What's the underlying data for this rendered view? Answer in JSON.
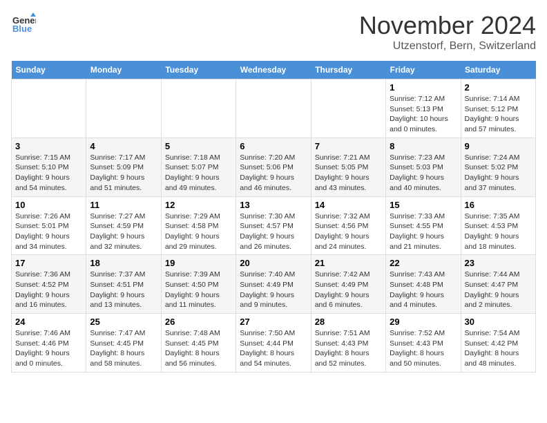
{
  "logo": {
    "line1": "General",
    "line2": "Blue"
  },
  "title": "November 2024",
  "subtitle": "Utzenstorf, Bern, Switzerland",
  "weekdays": [
    "Sunday",
    "Monday",
    "Tuesday",
    "Wednesday",
    "Thursday",
    "Friday",
    "Saturday"
  ],
  "weeks": [
    [
      {
        "day": "",
        "info": ""
      },
      {
        "day": "",
        "info": ""
      },
      {
        "day": "",
        "info": ""
      },
      {
        "day": "",
        "info": ""
      },
      {
        "day": "",
        "info": ""
      },
      {
        "day": "1",
        "info": "Sunrise: 7:12 AM\nSunset: 5:13 PM\nDaylight: 10 hours\nand 0 minutes."
      },
      {
        "day": "2",
        "info": "Sunrise: 7:14 AM\nSunset: 5:12 PM\nDaylight: 9 hours\nand 57 minutes."
      }
    ],
    [
      {
        "day": "3",
        "info": "Sunrise: 7:15 AM\nSunset: 5:10 PM\nDaylight: 9 hours\nand 54 minutes."
      },
      {
        "day": "4",
        "info": "Sunrise: 7:17 AM\nSunset: 5:09 PM\nDaylight: 9 hours\nand 51 minutes."
      },
      {
        "day": "5",
        "info": "Sunrise: 7:18 AM\nSunset: 5:07 PM\nDaylight: 9 hours\nand 49 minutes."
      },
      {
        "day": "6",
        "info": "Sunrise: 7:20 AM\nSunset: 5:06 PM\nDaylight: 9 hours\nand 46 minutes."
      },
      {
        "day": "7",
        "info": "Sunrise: 7:21 AM\nSunset: 5:05 PM\nDaylight: 9 hours\nand 43 minutes."
      },
      {
        "day": "8",
        "info": "Sunrise: 7:23 AM\nSunset: 5:03 PM\nDaylight: 9 hours\nand 40 minutes."
      },
      {
        "day": "9",
        "info": "Sunrise: 7:24 AM\nSunset: 5:02 PM\nDaylight: 9 hours\nand 37 minutes."
      }
    ],
    [
      {
        "day": "10",
        "info": "Sunrise: 7:26 AM\nSunset: 5:01 PM\nDaylight: 9 hours\nand 34 minutes."
      },
      {
        "day": "11",
        "info": "Sunrise: 7:27 AM\nSunset: 4:59 PM\nDaylight: 9 hours\nand 32 minutes."
      },
      {
        "day": "12",
        "info": "Sunrise: 7:29 AM\nSunset: 4:58 PM\nDaylight: 9 hours\nand 29 minutes."
      },
      {
        "day": "13",
        "info": "Sunrise: 7:30 AM\nSunset: 4:57 PM\nDaylight: 9 hours\nand 26 minutes."
      },
      {
        "day": "14",
        "info": "Sunrise: 7:32 AM\nSunset: 4:56 PM\nDaylight: 9 hours\nand 24 minutes."
      },
      {
        "day": "15",
        "info": "Sunrise: 7:33 AM\nSunset: 4:55 PM\nDaylight: 9 hours\nand 21 minutes."
      },
      {
        "day": "16",
        "info": "Sunrise: 7:35 AM\nSunset: 4:53 PM\nDaylight: 9 hours\nand 18 minutes."
      }
    ],
    [
      {
        "day": "17",
        "info": "Sunrise: 7:36 AM\nSunset: 4:52 PM\nDaylight: 9 hours\nand 16 minutes."
      },
      {
        "day": "18",
        "info": "Sunrise: 7:37 AM\nSunset: 4:51 PM\nDaylight: 9 hours\nand 13 minutes."
      },
      {
        "day": "19",
        "info": "Sunrise: 7:39 AM\nSunset: 4:50 PM\nDaylight: 9 hours\nand 11 minutes."
      },
      {
        "day": "20",
        "info": "Sunrise: 7:40 AM\nSunset: 4:49 PM\nDaylight: 9 hours\nand 9 minutes."
      },
      {
        "day": "21",
        "info": "Sunrise: 7:42 AM\nSunset: 4:49 PM\nDaylight: 9 hours\nand 6 minutes."
      },
      {
        "day": "22",
        "info": "Sunrise: 7:43 AM\nSunset: 4:48 PM\nDaylight: 9 hours\nand 4 minutes."
      },
      {
        "day": "23",
        "info": "Sunrise: 7:44 AM\nSunset: 4:47 PM\nDaylight: 9 hours\nand 2 minutes."
      }
    ],
    [
      {
        "day": "24",
        "info": "Sunrise: 7:46 AM\nSunset: 4:46 PM\nDaylight: 9 hours\nand 0 minutes."
      },
      {
        "day": "25",
        "info": "Sunrise: 7:47 AM\nSunset: 4:45 PM\nDaylight: 8 hours\nand 58 minutes."
      },
      {
        "day": "26",
        "info": "Sunrise: 7:48 AM\nSunset: 4:45 PM\nDaylight: 8 hours\nand 56 minutes."
      },
      {
        "day": "27",
        "info": "Sunrise: 7:50 AM\nSunset: 4:44 PM\nDaylight: 8 hours\nand 54 minutes."
      },
      {
        "day": "28",
        "info": "Sunrise: 7:51 AM\nSunset: 4:43 PM\nDaylight: 8 hours\nand 52 minutes."
      },
      {
        "day": "29",
        "info": "Sunrise: 7:52 AM\nSunset: 4:43 PM\nDaylight: 8 hours\nand 50 minutes."
      },
      {
        "day": "30",
        "info": "Sunrise: 7:54 AM\nSunset: 4:42 PM\nDaylight: 8 hours\nand 48 minutes."
      }
    ]
  ]
}
